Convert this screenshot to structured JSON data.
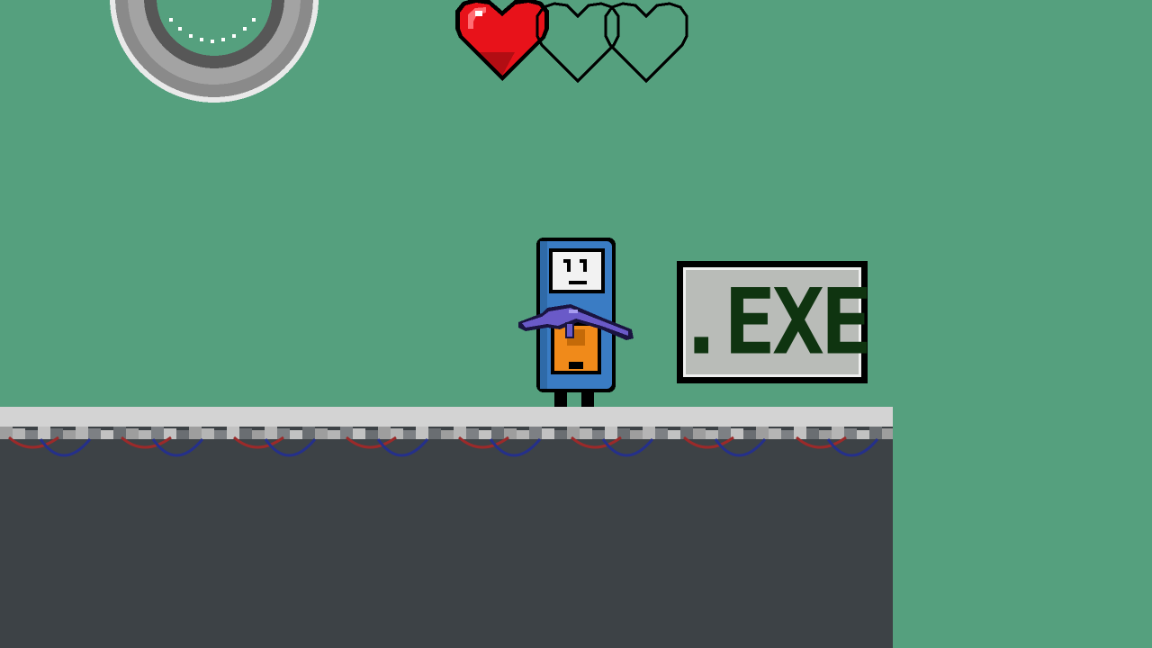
{
  "game": {
    "health": {
      "current": 1,
      "max": 3
    },
    "sign_text": ".EXE"
  },
  "colors": {
    "background": "#55a07e",
    "heart_full": "#e8121a",
    "heart_empty_outline": "#000000",
    "platform_top": "#d3d3d3",
    "platform_body": "#3d4246",
    "garland_red": "#9b2a2a",
    "garland_blue": "#25308a",
    "player_body": "#3a7cc4",
    "player_face": "#f2f2f2",
    "player_belly": "#f08a1a",
    "gun": "#6a5ac8",
    "sign_text": "#0f3410"
  },
  "icons": {
    "saw": "saw-blade-icon",
    "heart_full": "heart-full-icon",
    "heart_empty": "heart-empty-icon",
    "gun": "gun-icon"
  }
}
